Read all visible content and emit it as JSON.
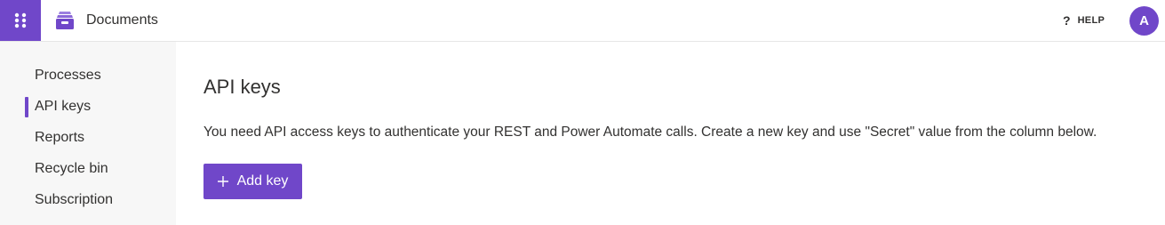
{
  "header": {
    "app_title": "Documents",
    "help_label": "HELP",
    "help_icon_glyph": "?",
    "avatar_initial": "A",
    "waffle_icon": "app-launcher-icon",
    "app_icon": "archive-box-icon"
  },
  "sidebar": {
    "items": [
      {
        "label": "Processes",
        "active": false
      },
      {
        "label": "API keys",
        "active": true
      },
      {
        "label": "Reports",
        "active": false
      },
      {
        "label": "Recycle bin",
        "active": false
      },
      {
        "label": "Subscription",
        "active": false
      }
    ]
  },
  "main": {
    "title": "API keys",
    "description": "You need API access keys to authenticate your REST and Power Automate calls. Create a new key and use \"Secret\" value from the column below.",
    "add_button_label": "Add key",
    "add_button_icon": "plus-icon"
  },
  "colors": {
    "accent": "#7047c9",
    "sidebar_bg": "#f7f7f7",
    "text": "#323130"
  }
}
